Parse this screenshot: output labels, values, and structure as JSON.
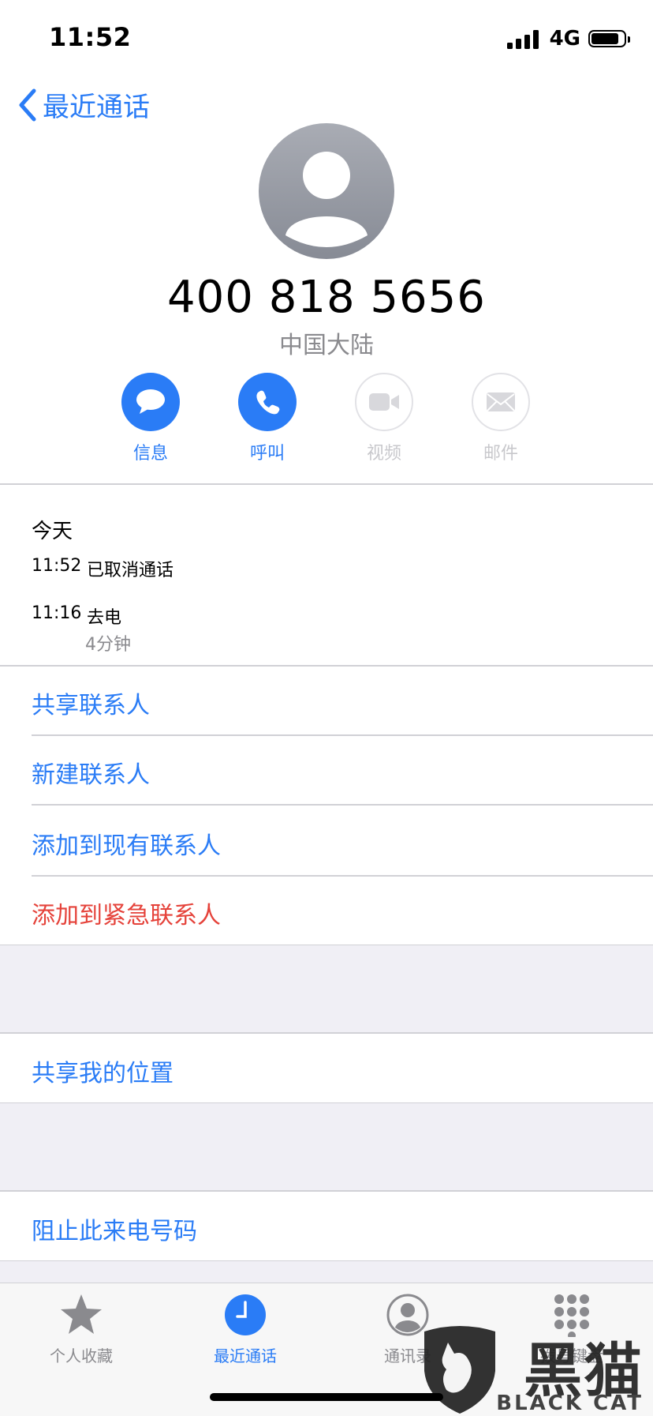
{
  "status_bar": {
    "time": "11:52",
    "network": "4G"
  },
  "nav": {
    "back_label": "最近通话"
  },
  "contact": {
    "number": "400 818 5656",
    "region": "中国大陆"
  },
  "actions": [
    {
      "label": "信息",
      "icon": "message-bubble-icon",
      "enabled": true
    },
    {
      "label": "呼叫",
      "icon": "phone-icon",
      "enabled": true
    },
    {
      "label": "视频",
      "icon": "video-camera-icon",
      "enabled": false
    },
    {
      "label": "邮件",
      "icon": "envelope-icon",
      "enabled": false
    }
  ],
  "history": {
    "date_label": "今天",
    "calls": [
      {
        "time": "11:52",
        "type": "已取消通话",
        "duration": ""
      },
      {
        "time": "11:16",
        "type": "去电",
        "duration": "4分钟"
      }
    ]
  },
  "options": {
    "share_contact": "共享联系人",
    "new_contact": "新建联系人",
    "add_existing": "添加到现有联系人",
    "add_emergency": "添加到紧急联系人",
    "share_location": "共享我的位置",
    "block_number": "阻止此来电号码"
  },
  "tabs": [
    {
      "label": "个人收藏",
      "icon": "star-icon",
      "active": false
    },
    {
      "label": "最近通话",
      "icon": "clock-icon",
      "active": true
    },
    {
      "label": "通讯录",
      "icon": "person-circle-icon",
      "active": false
    },
    {
      "label": "拨号键盘",
      "icon": "keypad-icon",
      "active": false
    }
  ],
  "watermark": {
    "text": "黑猫",
    "sub": "BLACK CAT"
  },
  "colors": {
    "accent": "#2a7cf6",
    "destructive": "#e5423a",
    "secondary_text": "#8a8a8e",
    "grouped_background": "#f0eff5"
  }
}
